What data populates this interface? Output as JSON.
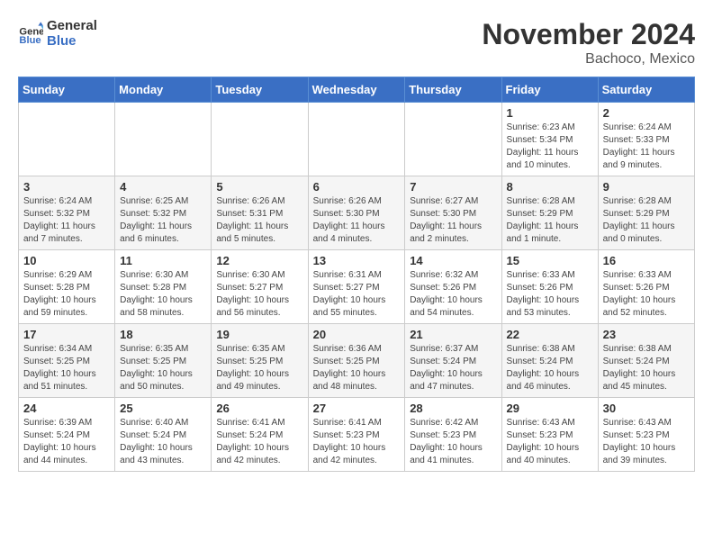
{
  "header": {
    "logo_line1": "General",
    "logo_line2": "Blue",
    "month_title": "November 2024",
    "location": "Bachoco, Mexico"
  },
  "weekdays": [
    "Sunday",
    "Monday",
    "Tuesday",
    "Wednesday",
    "Thursday",
    "Friday",
    "Saturday"
  ],
  "weeks": [
    [
      {
        "day": "",
        "info": ""
      },
      {
        "day": "",
        "info": ""
      },
      {
        "day": "",
        "info": ""
      },
      {
        "day": "",
        "info": ""
      },
      {
        "day": "",
        "info": ""
      },
      {
        "day": "1",
        "info": "Sunrise: 6:23 AM\nSunset: 5:34 PM\nDaylight: 11 hours and 10 minutes."
      },
      {
        "day": "2",
        "info": "Sunrise: 6:24 AM\nSunset: 5:33 PM\nDaylight: 11 hours and 9 minutes."
      }
    ],
    [
      {
        "day": "3",
        "info": "Sunrise: 6:24 AM\nSunset: 5:32 PM\nDaylight: 11 hours and 7 minutes."
      },
      {
        "day": "4",
        "info": "Sunrise: 6:25 AM\nSunset: 5:32 PM\nDaylight: 11 hours and 6 minutes."
      },
      {
        "day": "5",
        "info": "Sunrise: 6:26 AM\nSunset: 5:31 PM\nDaylight: 11 hours and 5 minutes."
      },
      {
        "day": "6",
        "info": "Sunrise: 6:26 AM\nSunset: 5:30 PM\nDaylight: 11 hours and 4 minutes."
      },
      {
        "day": "7",
        "info": "Sunrise: 6:27 AM\nSunset: 5:30 PM\nDaylight: 11 hours and 2 minutes."
      },
      {
        "day": "8",
        "info": "Sunrise: 6:28 AM\nSunset: 5:29 PM\nDaylight: 11 hours and 1 minute."
      },
      {
        "day": "9",
        "info": "Sunrise: 6:28 AM\nSunset: 5:29 PM\nDaylight: 11 hours and 0 minutes."
      }
    ],
    [
      {
        "day": "10",
        "info": "Sunrise: 6:29 AM\nSunset: 5:28 PM\nDaylight: 10 hours and 59 minutes."
      },
      {
        "day": "11",
        "info": "Sunrise: 6:30 AM\nSunset: 5:28 PM\nDaylight: 10 hours and 58 minutes."
      },
      {
        "day": "12",
        "info": "Sunrise: 6:30 AM\nSunset: 5:27 PM\nDaylight: 10 hours and 56 minutes."
      },
      {
        "day": "13",
        "info": "Sunrise: 6:31 AM\nSunset: 5:27 PM\nDaylight: 10 hours and 55 minutes."
      },
      {
        "day": "14",
        "info": "Sunrise: 6:32 AM\nSunset: 5:26 PM\nDaylight: 10 hours and 54 minutes."
      },
      {
        "day": "15",
        "info": "Sunrise: 6:33 AM\nSunset: 5:26 PM\nDaylight: 10 hours and 53 minutes."
      },
      {
        "day": "16",
        "info": "Sunrise: 6:33 AM\nSunset: 5:26 PM\nDaylight: 10 hours and 52 minutes."
      }
    ],
    [
      {
        "day": "17",
        "info": "Sunrise: 6:34 AM\nSunset: 5:25 PM\nDaylight: 10 hours and 51 minutes."
      },
      {
        "day": "18",
        "info": "Sunrise: 6:35 AM\nSunset: 5:25 PM\nDaylight: 10 hours and 50 minutes."
      },
      {
        "day": "19",
        "info": "Sunrise: 6:35 AM\nSunset: 5:25 PM\nDaylight: 10 hours and 49 minutes."
      },
      {
        "day": "20",
        "info": "Sunrise: 6:36 AM\nSunset: 5:25 PM\nDaylight: 10 hours and 48 minutes."
      },
      {
        "day": "21",
        "info": "Sunrise: 6:37 AM\nSunset: 5:24 PM\nDaylight: 10 hours and 47 minutes."
      },
      {
        "day": "22",
        "info": "Sunrise: 6:38 AM\nSunset: 5:24 PM\nDaylight: 10 hours and 46 minutes."
      },
      {
        "day": "23",
        "info": "Sunrise: 6:38 AM\nSunset: 5:24 PM\nDaylight: 10 hours and 45 minutes."
      }
    ],
    [
      {
        "day": "24",
        "info": "Sunrise: 6:39 AM\nSunset: 5:24 PM\nDaylight: 10 hours and 44 minutes."
      },
      {
        "day": "25",
        "info": "Sunrise: 6:40 AM\nSunset: 5:24 PM\nDaylight: 10 hours and 43 minutes."
      },
      {
        "day": "26",
        "info": "Sunrise: 6:41 AM\nSunset: 5:24 PM\nDaylight: 10 hours and 42 minutes."
      },
      {
        "day": "27",
        "info": "Sunrise: 6:41 AM\nSunset: 5:23 PM\nDaylight: 10 hours and 42 minutes."
      },
      {
        "day": "28",
        "info": "Sunrise: 6:42 AM\nSunset: 5:23 PM\nDaylight: 10 hours and 41 minutes."
      },
      {
        "day": "29",
        "info": "Sunrise: 6:43 AM\nSunset: 5:23 PM\nDaylight: 10 hours and 40 minutes."
      },
      {
        "day": "30",
        "info": "Sunrise: 6:43 AM\nSunset: 5:23 PM\nDaylight: 10 hours and 39 minutes."
      }
    ]
  ]
}
